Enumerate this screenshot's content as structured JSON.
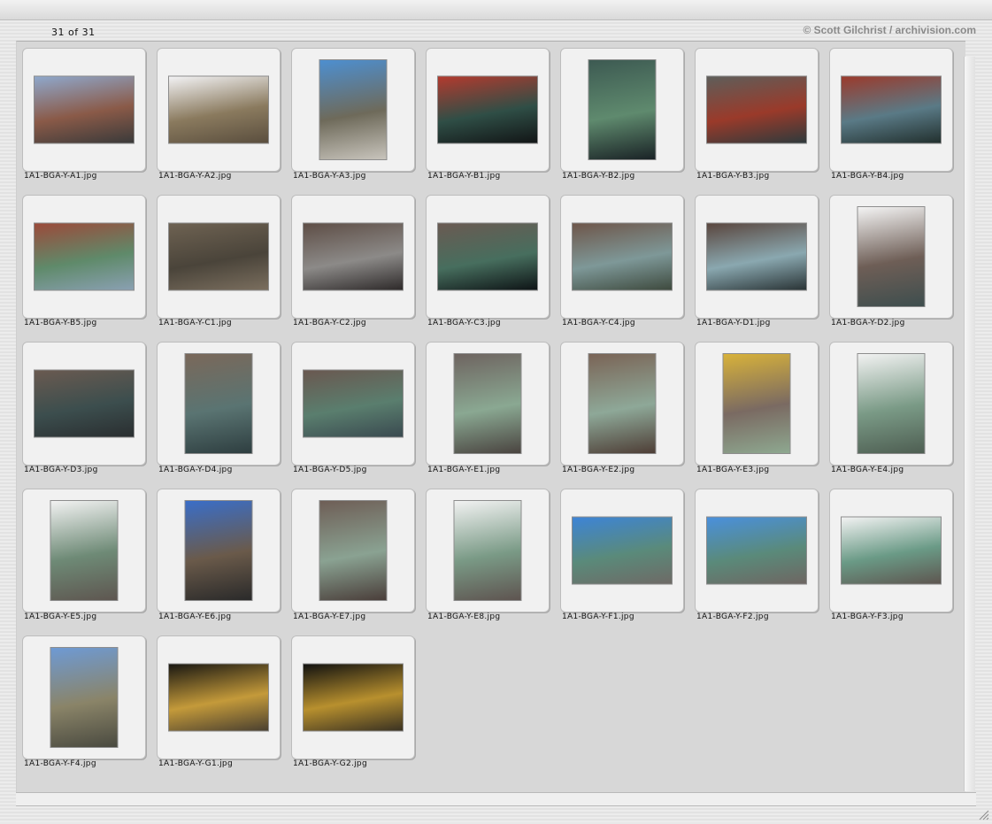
{
  "header": {
    "counter": "31 of 31",
    "copyright": "© Scott Gilchrist / archivision.com"
  },
  "thumbnails": [
    {
      "filename": "1A1-BGA-Y-A1.jpg",
      "orientation": "landscape",
      "colors": [
        "#8fa8cc",
        "#8a5a48",
        "#3a3a3a"
      ]
    },
    {
      "filename": "1A1-BGA-Y-A2.jpg",
      "orientation": "landscape",
      "colors": [
        "#f2f2f4",
        "#8a7a5e",
        "#5a4e3e"
      ]
    },
    {
      "filename": "1A1-BGA-Y-A3.jpg",
      "orientation": "portrait",
      "colors": [
        "#4d8fd0",
        "#6e6a5a",
        "#c8c4bc"
      ]
    },
    {
      "filename": "1A1-BGA-Y-B1.jpg",
      "orientation": "landscape",
      "colors": [
        "#b33a2e",
        "#2f4e46",
        "#121516"
      ]
    },
    {
      "filename": "1A1-BGA-Y-B2.jpg",
      "orientation": "portrait",
      "colors": [
        "#3d5a52",
        "#5f8a6e",
        "#1a2326"
      ]
    },
    {
      "filename": "1A1-BGA-Y-B3.jpg",
      "orientation": "landscape",
      "colors": [
        "#5e5e5a",
        "#9a3a2a",
        "#2e3a3c"
      ]
    },
    {
      "filename": "1A1-BGA-Y-B4.jpg",
      "orientation": "landscape",
      "colors": [
        "#9b3a2c",
        "#5a7a86",
        "#22302e"
      ]
    },
    {
      "filename": "1A1-BGA-Y-B5.jpg",
      "orientation": "landscape",
      "colors": [
        "#9b4a3a",
        "#5f8a6a",
        "#8aa0b2"
      ]
    },
    {
      "filename": "1A1-BGA-Y-C1.jpg",
      "orientation": "landscape",
      "colors": [
        "#6e6252",
        "#4a443a",
        "#7a6e5e"
      ]
    },
    {
      "filename": "1A1-BGA-Y-C2.jpg",
      "orientation": "landscape",
      "colors": [
        "#5e4e46",
        "#8c8a88",
        "#2e2a2a"
      ]
    },
    {
      "filename": "1A1-BGA-Y-C3.jpg",
      "orientation": "landscape",
      "colors": [
        "#6a5a52",
        "#476e5e",
        "#0e1416"
      ]
    },
    {
      "filename": "1A1-BGA-Y-C4.jpg",
      "orientation": "landscape",
      "colors": [
        "#6e564a",
        "#7e9898",
        "#3e4a3e"
      ]
    },
    {
      "filename": "1A1-BGA-Y-D1.jpg",
      "orientation": "landscape",
      "colors": [
        "#5a463e",
        "#8aa8b0",
        "#2a3436"
      ]
    },
    {
      "filename": "1A1-BGA-Y-D2.jpg",
      "orientation": "portrait",
      "colors": [
        "#f4f4f4",
        "#6e5e56",
        "#3e4e4e"
      ]
    },
    {
      "filename": "1A1-BGA-Y-D3.jpg",
      "orientation": "landscape",
      "colors": [
        "#6a5a50",
        "#3c4e4e",
        "#2a2e30"
      ]
    },
    {
      "filename": "1A1-BGA-Y-D4.jpg",
      "orientation": "portrait",
      "colors": [
        "#7a685a",
        "#5a7472",
        "#2e3e40"
      ]
    },
    {
      "filename": "1A1-BGA-Y-D5.jpg",
      "orientation": "landscape",
      "colors": [
        "#6a5850",
        "#5a7e6e",
        "#3a4a50"
      ]
    },
    {
      "filename": "1A1-BGA-Y-E1.jpg",
      "orientation": "portrait",
      "colors": [
        "#6e6460",
        "#8aa892",
        "#4a4440"
      ]
    },
    {
      "filename": "1A1-BGA-Y-E2.jpg",
      "orientation": "portrait",
      "colors": [
        "#7a6456",
        "#8ea898",
        "#4e3e36"
      ]
    },
    {
      "filename": "1A1-BGA-Y-E3.jpg",
      "orientation": "portrait",
      "colors": [
        "#d8b23a",
        "#7a6a62",
        "#8ea890"
      ]
    },
    {
      "filename": "1A1-BGA-Y-E4.jpg",
      "orientation": "portrait",
      "colors": [
        "#f2f2f2",
        "#7a9a86",
        "#4e5e52"
      ]
    },
    {
      "filename": "1A1-BGA-Y-E5.jpg",
      "orientation": "portrait",
      "colors": [
        "#f2f2f2",
        "#6e8a76",
        "#5e5650"
      ]
    },
    {
      "filename": "1A1-BGA-Y-E6.jpg",
      "orientation": "portrait",
      "colors": [
        "#3a6ec8",
        "#6a5a4a",
        "#2a2a2a"
      ]
    },
    {
      "filename": "1A1-BGA-Y-E7.jpg",
      "orientation": "portrait",
      "colors": [
        "#6e5e56",
        "#8aa292",
        "#4a3e3a"
      ]
    },
    {
      "filename": "1A1-BGA-Y-E8.jpg",
      "orientation": "portrait",
      "colors": [
        "#f2f2f2",
        "#7a9a86",
        "#5e5450"
      ]
    },
    {
      "filename": "1A1-BGA-Y-F1.jpg",
      "orientation": "landscape",
      "colors": [
        "#3d84d6",
        "#5a8a7a",
        "#6e6a66"
      ]
    },
    {
      "filename": "1A1-BGA-Y-F2.jpg",
      "orientation": "landscape",
      "colors": [
        "#4a90dc",
        "#5a8a7a",
        "#6e6662"
      ]
    },
    {
      "filename": "1A1-BGA-Y-F3.jpg",
      "orientation": "landscape",
      "colors": [
        "#f2f2f2",
        "#6a9a86",
        "#5e5650"
      ]
    },
    {
      "filename": "1A1-BGA-Y-F4.jpg",
      "orientation": "portrait",
      "colors": [
        "#6e9ad4",
        "#8a8468",
        "#4a4a40"
      ]
    },
    {
      "filename": "1A1-BGA-Y-G1.jpg",
      "orientation": "landscape",
      "colors": [
        "#1a1812",
        "#c49a3a",
        "#4a4030"
      ]
    },
    {
      "filename": "1A1-BGA-Y-G2.jpg",
      "orientation": "landscape",
      "colors": [
        "#121210",
        "#b8902e",
        "#3a3222"
      ]
    }
  ]
}
